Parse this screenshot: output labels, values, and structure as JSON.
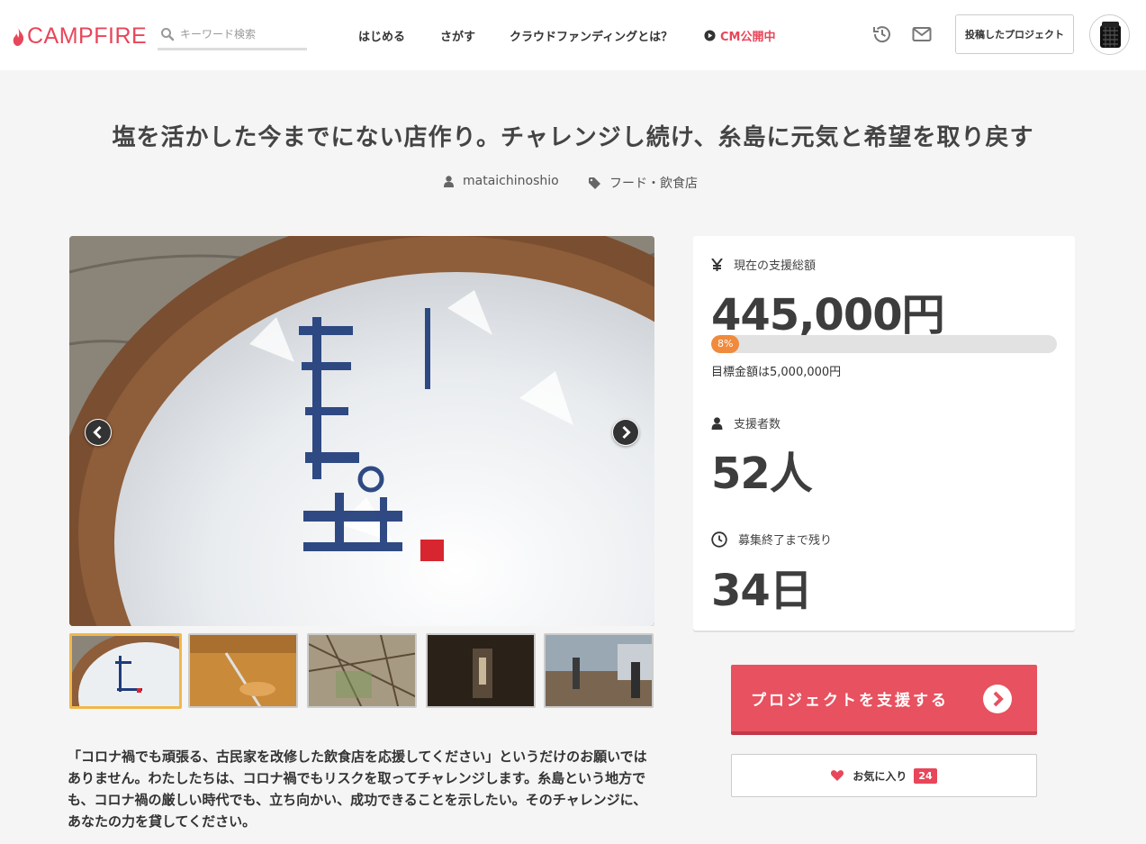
{
  "header": {
    "logo_text": "CAMPFIRE",
    "search_placeholder": "キーワード検索",
    "nav": [
      {
        "label": "はじめる"
      },
      {
        "label": "さがす"
      },
      {
        "label": "クラウドファンディングとは？"
      },
      {
        "label": "CM公開中"
      }
    ],
    "posted_projects_label": "投稿したプロジェクト",
    "icons": [
      "history-icon",
      "mail-icon"
    ]
  },
  "project": {
    "title": "塩を活かした今までにない店作り。チャレンジし続け、糸島に元気と希望を取り戻す",
    "owner": "mataichinoshio",
    "category": "フード・飲食店",
    "description": "「コロナ禍でも頑張る、古民家を改修した飲食店を応援してください」というだけのお願いではありません。わたしたちは、コロナ禍でもリスクを取ってチャレンジします。糸島という地方でも、コロナ禍の厳しい時代でも、立ち向かい、成功できることを示したい。そのチャレンジに、あなたの力を貸してください。"
  },
  "stats": {
    "total_label": "現在の支援総額",
    "total_value": "445,000円",
    "progress_text": "8%",
    "progress_percent": 8,
    "goal_text": "目標金額は5,000,000円",
    "backers_label": "支援者数",
    "backers_value": "52人",
    "remaining_label": "募集終了まで残り",
    "remaining_value": "34日"
  },
  "actions": {
    "support_label": "プロジェクトを支援する",
    "favorite_label": "お気に入り",
    "favorite_count": "24"
  },
  "colors": {
    "brand": "#e8465a",
    "progress": "#f08a3c",
    "button": "#e8515f"
  }
}
